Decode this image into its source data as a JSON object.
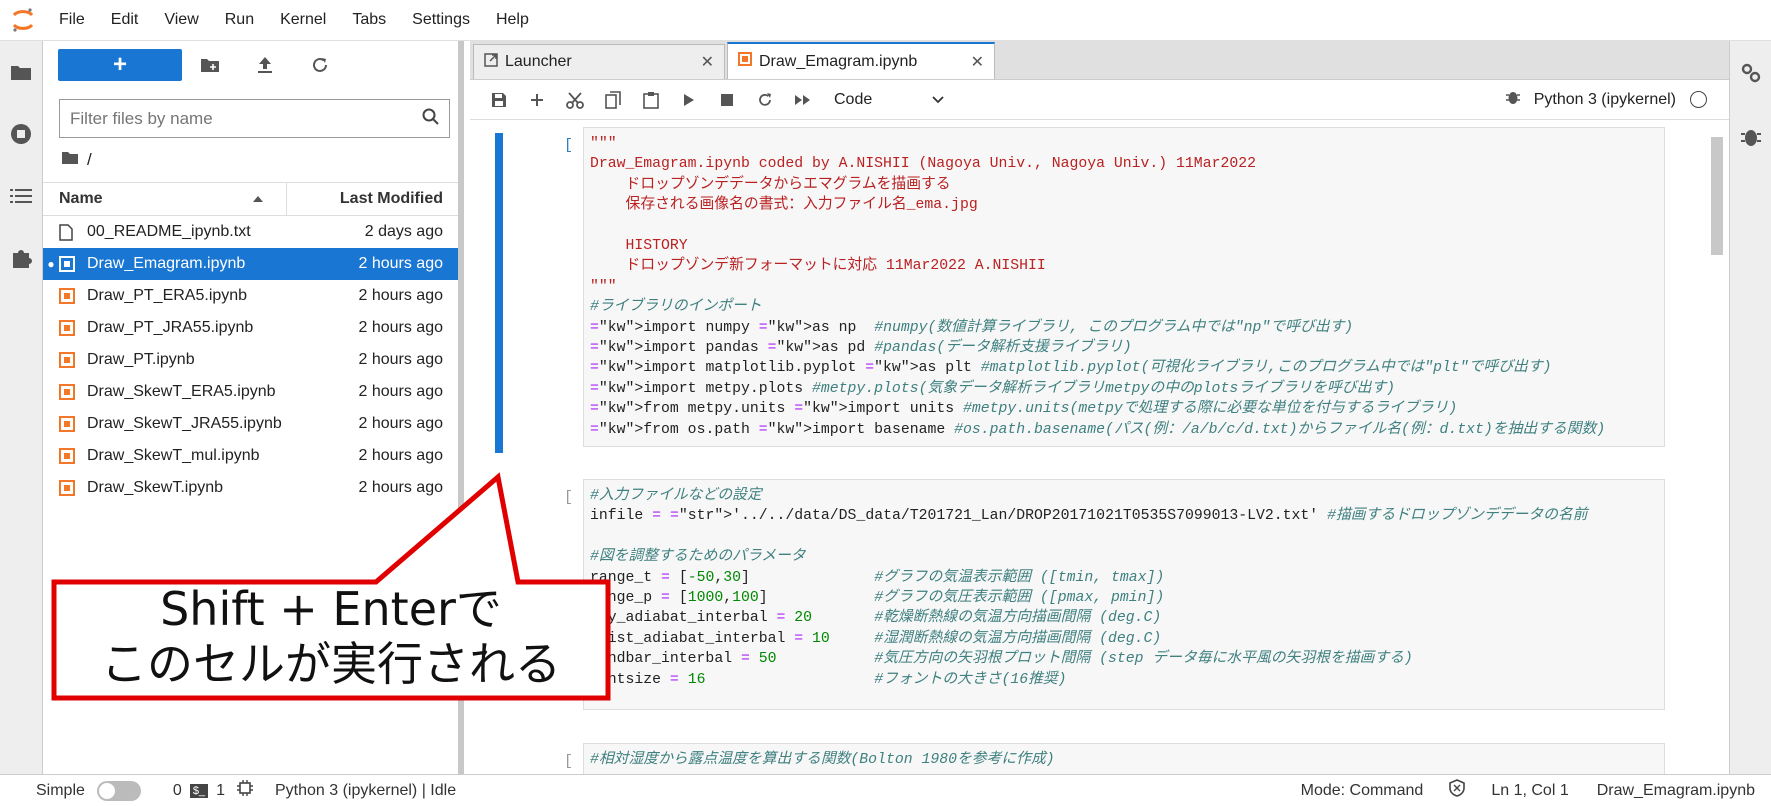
{
  "menubar": {
    "items": [
      "File",
      "Edit",
      "View",
      "Run",
      "Kernel",
      "Tabs",
      "Settings",
      "Help"
    ]
  },
  "filebrowser": {
    "filter_placeholder": "Filter files by name",
    "breadcrumb": "/",
    "col_name": "Name",
    "col_modified": "Last Modified",
    "files": [
      {
        "name": "00_README_ipynb.txt",
        "modified": "2 days ago",
        "type": "text",
        "selected": false
      },
      {
        "name": "Draw_Emagram.ipynb",
        "modified": "2 hours ago",
        "type": "notebook",
        "selected": true
      },
      {
        "name": "Draw_PT_ERA5.ipynb",
        "modified": "2 hours ago",
        "type": "notebook",
        "selected": false
      },
      {
        "name": "Draw_PT_JRA55.ipynb",
        "modified": "2 hours ago",
        "type": "notebook",
        "selected": false
      },
      {
        "name": "Draw_PT.ipynb",
        "modified": "2 hours ago",
        "type": "notebook",
        "selected": false
      },
      {
        "name": "Draw_SkewT_ERA5.ipynb",
        "modified": "2 hours ago",
        "type": "notebook",
        "selected": false
      },
      {
        "name": "Draw_SkewT_JRA55.ipynb",
        "modified": "2 hours ago",
        "type": "notebook",
        "selected": false
      },
      {
        "name": "Draw_SkewT_mul.ipynb",
        "modified": "2 hours ago",
        "type": "notebook",
        "selected": false
      },
      {
        "name": "Draw_SkewT.ipynb",
        "modified": "2 hours ago",
        "type": "notebook",
        "selected": false
      }
    ]
  },
  "tabs": [
    {
      "label": "Launcher",
      "active": false
    },
    {
      "label": "Draw_Emagram.ipynb",
      "active": true
    }
  ],
  "notebook": {
    "cell_type": "Code",
    "kernel": "Python 3 (ipykernel)",
    "prompts": [
      "[ ]:",
      "[ ]:",
      "[ ]:"
    ],
    "cell1": [
      "\"\"\"",
      "Draw_Emagram.ipynb coded by A.NISHII (Nagoya Univ., Nagoya Univ.) 11Mar2022",
      "    ドロップゾンデデータからエマグラムを描画する",
      "    保存される画像名の書式：入力ファイル名_ema.jpg",
      "",
      "    HISTORY",
      "    ドロップゾンデ新フォーマットに対応 11Mar2022 A.NISHII",
      "\"\"\"",
      "#ライブラリのインポート",
      "import numpy as np  #numpy(数値計算ライブラリ, このプログラム中では\"np\"で呼び出す)",
      "import pandas as pd #pandas(データ解析支援ライブラリ)",
      "import matplotlib.pyplot as plt #matplotlib.pyplot(可視化ライブラリ,このプログラム中では\"plt\"で呼び出す)",
      "import metpy.plots #metpy.plots(気象データ解析ライブラリmetpyの中のplotsライブラリを呼び出す)",
      "from metpy.units import units #metpy.units(metpyで処理する際に必要な単位を付与するライブラリ)",
      "from os.path import basename #os.path.basename(パス(例：/a/b/c/d.txt)からファイル名(例：d.txt)を抽出する関数)"
    ],
    "cell2": [
      "#入力ファイルなどの設定",
      "infile = '../../data/DS_data/T201721_Lan/DROP20171021T0535S7099013-LV2.txt' #描画するドロップゾンデデータの名前",
      "",
      "#図を調整するためのパラメータ",
      "range_t = [-50,30]              #グラフの気温表示範囲 ([tmin, tmax])",
      "range_p = [1000,100]            #グラフの気圧表示範囲 ([pmax, pmin])",
      "dry_adiabat_interbal = 20       #乾燥断熱線の気温方向描画間隔 (deg.C)",
      "moist_adiabat_interbal = 10     #湿潤断熱線の気温方向描画間隔 (deg.C)",
      "windbar_interbal = 50           #気圧方向の矢羽根プロット間隔 (step データ毎に水平風の矢羽根を描画する)",
      "fontsize = 16                   #フォントの大きさ(16推奨)"
    ],
    "cell3": [
      "#相対湿度から露点温度を算出する関数(Bolton 1980を参考に作成)"
    ]
  },
  "callout": {
    "line1": "Shift + Enterで",
    "line2": "このセルが実行される"
  },
  "statusbar": {
    "mode_label": "Simple",
    "count1": "0",
    "count2": "1",
    "kernel_status": "Python 3 (ipykernel) | Idle",
    "mode": "Mode: Command",
    "position": "Ln 1, Col 1",
    "filename": "Draw_Emagram.ipynb"
  },
  "colors": {
    "accent": "#1976d2",
    "notebook_icon": "#f37726",
    "callout_border": "#e00000"
  }
}
